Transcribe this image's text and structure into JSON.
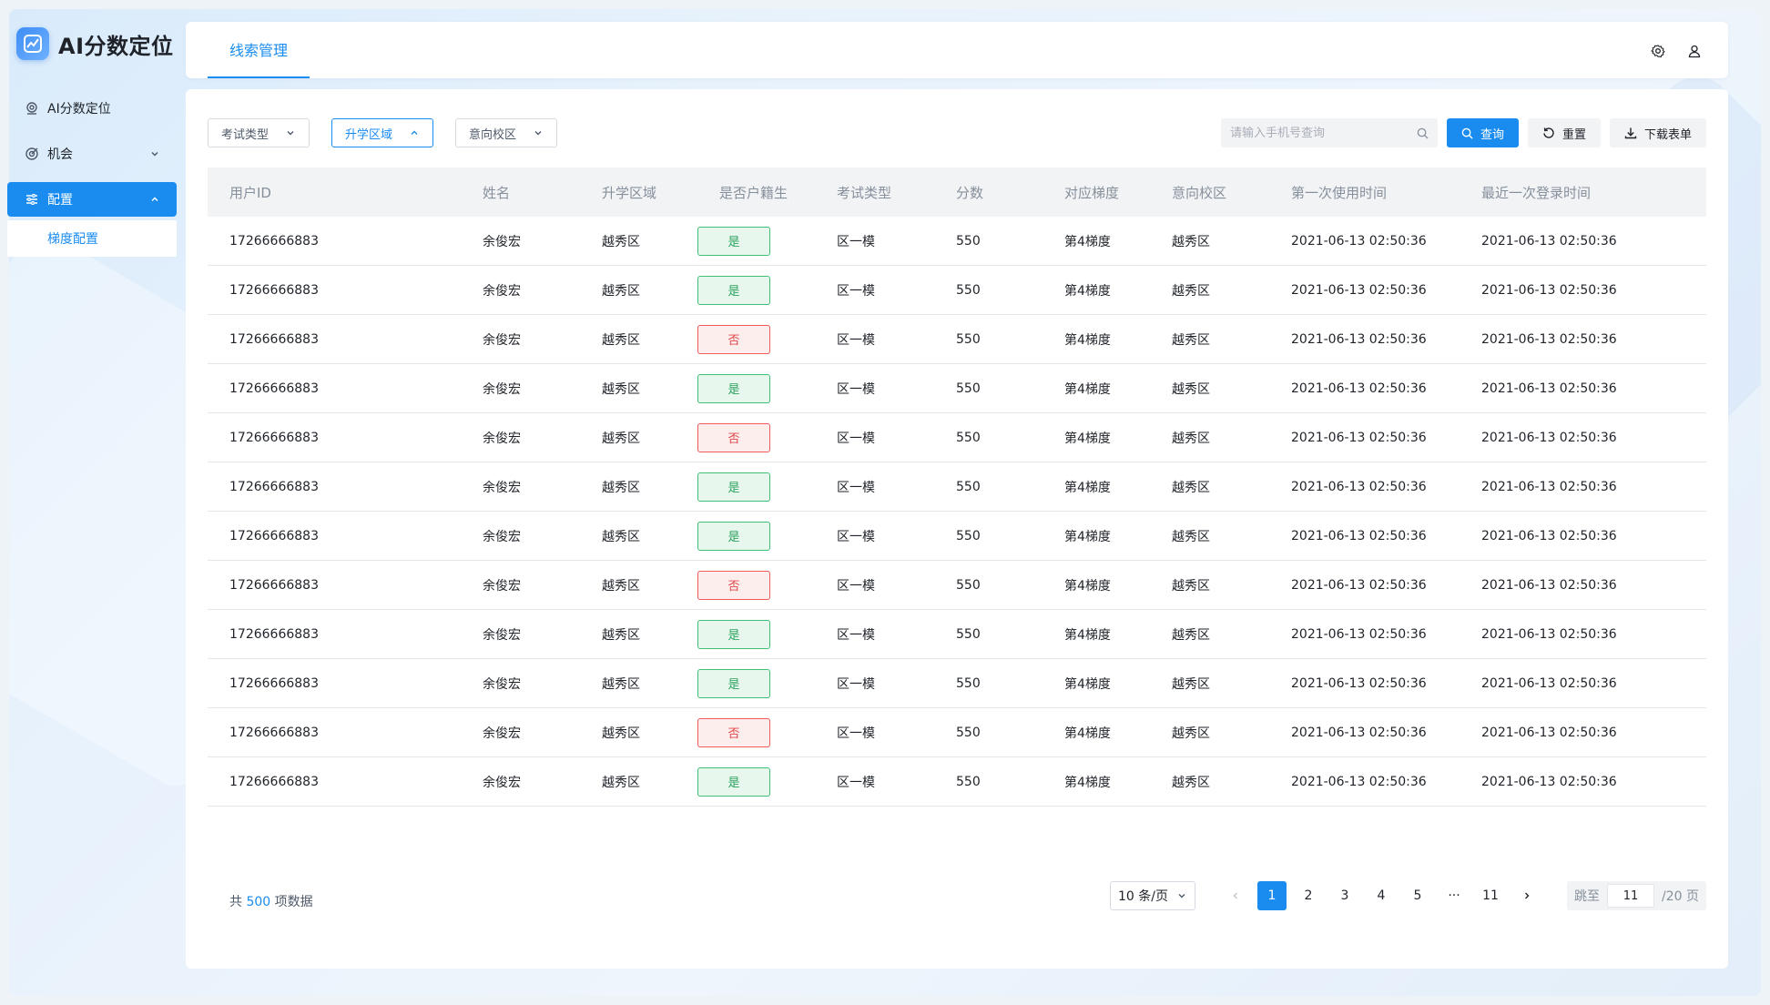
{
  "app": {
    "title": "AI分数定位"
  },
  "sidebar": {
    "items": [
      {
        "label": "AI分数定位"
      },
      {
        "label": "机会"
      },
      {
        "label": "配置"
      }
    ],
    "subitem": "梯度配置"
  },
  "header": {
    "tab": "线索管理"
  },
  "filters": {
    "exam_type": "考试类型",
    "region": "升学区域",
    "campus": "意向校区"
  },
  "search": {
    "placeholder": "请输入手机号查询"
  },
  "buttons": {
    "query": "查询",
    "reset": "重置",
    "download": "下载表单"
  },
  "table": {
    "headers": [
      "用户ID",
      "姓名",
      "升学区域",
      "是否户籍生",
      "考试类型",
      "分数",
      "对应梯度",
      "意向校区",
      "第一次使用时间",
      "最近一次登录时间"
    ],
    "rows": [
      [
        "17266666883",
        "余俊宏",
        "越秀区",
        "是",
        "区一模",
        "550",
        "第4梯度",
        "越秀区",
        "2021-06-13 02:50:36",
        "2021-06-13 02:50:36"
      ],
      [
        "17266666883",
        "余俊宏",
        "越秀区",
        "是",
        "区一模",
        "550",
        "第4梯度",
        "越秀区",
        "2021-06-13 02:50:36",
        "2021-06-13 02:50:36"
      ],
      [
        "17266666883",
        "余俊宏",
        "越秀区",
        "否",
        "区一模",
        "550",
        "第4梯度",
        "越秀区",
        "2021-06-13 02:50:36",
        "2021-06-13 02:50:36"
      ],
      [
        "17266666883",
        "余俊宏",
        "越秀区",
        "是",
        "区一模",
        "550",
        "第4梯度",
        "越秀区",
        "2021-06-13 02:50:36",
        "2021-06-13 02:50:36"
      ],
      [
        "17266666883",
        "余俊宏",
        "越秀区",
        "否",
        "区一模",
        "550",
        "第4梯度",
        "越秀区",
        "2021-06-13 02:50:36",
        "2021-06-13 02:50:36"
      ],
      [
        "17266666883",
        "余俊宏",
        "越秀区",
        "是",
        "区一模",
        "550",
        "第4梯度",
        "越秀区",
        "2021-06-13 02:50:36",
        "2021-06-13 02:50:36"
      ],
      [
        "17266666883",
        "余俊宏",
        "越秀区",
        "是",
        "区一模",
        "550",
        "第4梯度",
        "越秀区",
        "2021-06-13 02:50:36",
        "2021-06-13 02:50:36"
      ],
      [
        "17266666883",
        "余俊宏",
        "越秀区",
        "否",
        "区一模",
        "550",
        "第4梯度",
        "越秀区",
        "2021-06-13 02:50:36",
        "2021-06-13 02:50:36"
      ],
      [
        "17266666883",
        "余俊宏",
        "越秀区",
        "是",
        "区一模",
        "550",
        "第4梯度",
        "越秀区",
        "2021-06-13 02:50:36",
        "2021-06-13 02:50:36"
      ],
      [
        "17266666883",
        "余俊宏",
        "越秀区",
        "是",
        "区一模",
        "550",
        "第4梯度",
        "越秀区",
        "2021-06-13 02:50:36",
        "2021-06-13 02:50:36"
      ],
      [
        "17266666883",
        "余俊宏",
        "越秀区",
        "否",
        "区一模",
        "550",
        "第4梯度",
        "越秀区",
        "2021-06-13 02:50:36",
        "2021-06-13 02:50:36"
      ],
      [
        "17266666883",
        "余俊宏",
        "越秀区",
        "是",
        "区一模",
        "550",
        "第4梯度",
        "越秀区",
        "2021-06-13 02:50:36",
        "2021-06-13 02:50:36"
      ]
    ]
  },
  "footer": {
    "total_prefix": "共",
    "total_count": "500",
    "total_suffix": "项数据",
    "page_size": "10 条/页",
    "pages": [
      "1",
      "2",
      "3",
      "4",
      "5",
      "···",
      "11"
    ],
    "current_page": "1",
    "jump_label": "跳至",
    "jump_value": "11",
    "page_total": "/20 页"
  },
  "colors": {
    "accent": "#1a8cf0",
    "yes": "#2aa35e",
    "no": "#e04848"
  }
}
